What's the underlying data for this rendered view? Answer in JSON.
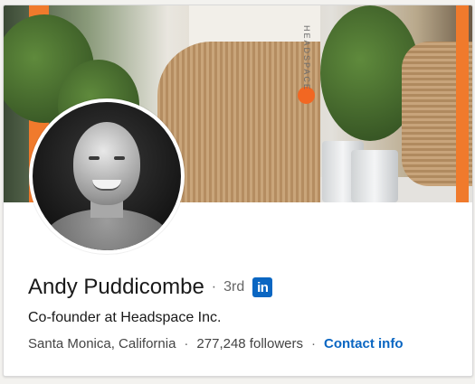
{
  "profile": {
    "name": "Andy Puddicombe",
    "separator": "·",
    "connection_degree": "3rd",
    "linkedin_badge": "in",
    "headline": "Co-founder at Headspace Inc.",
    "location": "Santa Monica, California",
    "followers": "277,248 followers",
    "contact_info_label": "Contact info"
  },
  "banner": {
    "brand_text": "HEADSPACE"
  },
  "colors": {
    "link": "#0a66c2",
    "brand_orange": "#f07a2c",
    "text_primary": "#191919",
    "text_secondary": "#666666"
  },
  "icons": {
    "linkedin": "linkedin-icon"
  }
}
